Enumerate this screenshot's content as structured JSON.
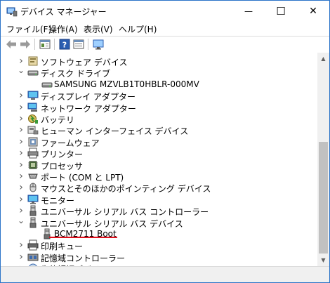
{
  "window": {
    "title": "デバイス マネージャー",
    "minimize_glyph": "—",
    "maximize_glyph": "☐",
    "close_glyph": "✕"
  },
  "menu": {
    "items": [
      "ファイル(F)",
      "操作(A)",
      "表示(V)",
      "ヘルプ(H)"
    ]
  },
  "toolbar": {
    "buttons": [
      "back-icon",
      "forward-icon",
      "properties-icon",
      "help-icon",
      "view-icon",
      "monitor-icon"
    ]
  },
  "tree": {
    "items": [
      {
        "label": "ソフトウェア デバイス",
        "icon": "software-device-icon",
        "state": "collapsed"
      },
      {
        "label": "ディスク ドライブ",
        "icon": "disk-drive-icon",
        "state": "expanded"
      },
      {
        "label": "SAMSUNG MZVLB1T0HBLR-000MV",
        "icon": "disk-drive-icon",
        "state": "leaf"
      },
      {
        "label": "ディスプレイ アダプター",
        "icon": "display-adapter-icon",
        "state": "collapsed"
      },
      {
        "label": "ネットワーク アダプター",
        "icon": "network-adapter-icon",
        "state": "collapsed"
      },
      {
        "label": "バッテリ",
        "icon": "battery-icon",
        "state": "collapsed"
      },
      {
        "label": "ヒューマン インターフェイス デバイス",
        "icon": "hid-icon",
        "state": "collapsed"
      },
      {
        "label": "ファームウェア",
        "icon": "firmware-icon",
        "state": "collapsed"
      },
      {
        "label": "プリンター",
        "icon": "printer-icon",
        "state": "collapsed"
      },
      {
        "label": "プロセッサ",
        "icon": "processor-icon",
        "state": "collapsed"
      },
      {
        "label": "ポート (COM と LPT)",
        "icon": "port-icon",
        "state": "collapsed"
      },
      {
        "label": "マウスとそのほかのポインティング デバイス",
        "icon": "mouse-icon",
        "state": "collapsed"
      },
      {
        "label": "モニター",
        "icon": "monitor-icon",
        "state": "collapsed"
      },
      {
        "label": "ユニバーサル シリアル バス コントローラー",
        "icon": "usb-icon",
        "state": "collapsed"
      },
      {
        "label": "ユニバーサル シリアル バス デバイス",
        "icon": "usb-icon",
        "state": "expanded"
      },
      {
        "label": "BCM2711 Boot",
        "icon": "usb-device-icon",
        "state": "leaf"
      },
      {
        "label": "印刷キュー",
        "icon": "print-queue-icon",
        "state": "collapsed"
      },
      {
        "label": "記憶域コントローラー",
        "icon": "storage-controller-icon",
        "state": "collapsed"
      },
      {
        "label": "生体認証デバイス",
        "icon": "biometric-icon",
        "state": "collapsed"
      }
    ]
  },
  "colors": {
    "highlight_underline": "#e0101d",
    "window_border": "#2b73c8"
  }
}
